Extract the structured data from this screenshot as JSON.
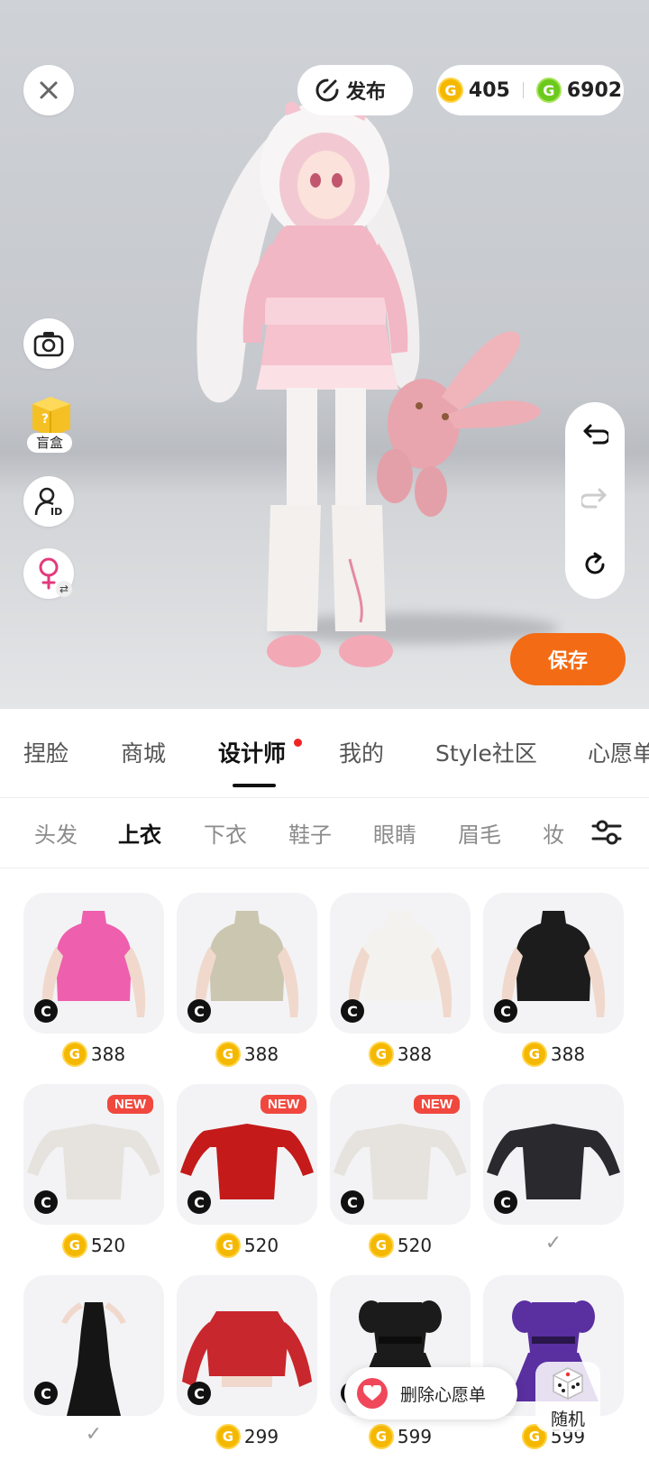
{
  "header": {
    "publish_label": "发布",
    "gold_balance": "405",
    "green_balance": "6902"
  },
  "sidebar": {
    "blindbox_label": "盲盒"
  },
  "save_label": "保存",
  "tabs": [
    {
      "label": "捏脸"
    },
    {
      "label": "商城"
    },
    {
      "label": "设计师"
    },
    {
      "label": "我的"
    },
    {
      "label": "Style社区"
    },
    {
      "label": "心愿单"
    }
  ],
  "subtabs": [
    {
      "label": "头发"
    },
    {
      "label": "上衣"
    },
    {
      "label": "下衣"
    },
    {
      "label": "鞋子"
    },
    {
      "label": "眼睛"
    },
    {
      "label": "眉毛"
    },
    {
      "label": "妆"
    }
  ],
  "items": [
    {
      "price": "388",
      "new": false,
      "color": "#ee5fae",
      "kind": "halter"
    },
    {
      "price": "388",
      "new": false,
      "color": "#cbc6b0",
      "kind": "halter"
    },
    {
      "price": "388",
      "new": false,
      "color": "#f4f2ee",
      "kind": "halter"
    },
    {
      "price": "388",
      "new": false,
      "color": "#1c1c1c",
      "kind": "halter"
    },
    {
      "price": "520",
      "new": true,
      "color": "#e6e3de",
      "kind": "dress",
      "new_label": "NEW"
    },
    {
      "price": "520",
      "new": true,
      "color": "#c41a1a",
      "kind": "dress",
      "new_label": "NEW"
    },
    {
      "price": "520",
      "new": true,
      "color": "#e6e3de",
      "kind": "dress",
      "new_label": "NEW"
    },
    {
      "price": "",
      "owned": true,
      "check": "✓",
      "color": "#2a2a2e",
      "kind": "dress"
    },
    {
      "price": "",
      "owned": true,
      "check": "✓",
      "color": "#151515",
      "kind": "gown"
    },
    {
      "price": "299",
      "new": false,
      "color": "#c8272d",
      "kind": "sweater"
    },
    {
      "price": "599",
      "new": false,
      "color": "#1b1b1b",
      "kind": "lolita"
    },
    {
      "price": "599",
      "new": false,
      "color": "#5a2fa0",
      "kind": "lolita"
    }
  ],
  "wishlist_remove_label": "删除心愿单",
  "random_label": "随机",
  "colors": {
    "accent_orange": "#f36b14",
    "coin_gold": "#f5b800",
    "coin_green": "#6cc91e",
    "new_badge": "#f0483e",
    "wish_heart": "#f0475a"
  }
}
